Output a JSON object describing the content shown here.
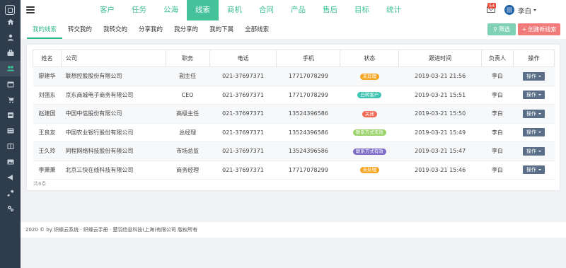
{
  "top_nav": {
    "items": [
      "客户",
      "任务",
      "公海",
      "线索",
      "商机",
      "合同",
      "产品",
      "售后",
      "目标",
      "统计"
    ],
    "active": "线索"
  },
  "user": {
    "name": "李白",
    "mail_badge": "54"
  },
  "sub_tabs": {
    "items": [
      "我的线索",
      "转交我的",
      "我转交的",
      "分享我的",
      "我分享的",
      "我的下属",
      "全部线索"
    ],
    "active": "我的线索"
  },
  "actions": {
    "filter_label": "筛选",
    "create_label": "创建新线索"
  },
  "table": {
    "headers": [
      "姓名",
      "公司",
      "职务",
      "电话",
      "手机",
      "状态",
      "跟进时间",
      "负责人",
      "操作"
    ],
    "rows": [
      {
        "name": "廖建华",
        "company": "联想控股股份有限公司",
        "title": "副主任",
        "phone": "021-37697371",
        "mobile": "17717078299",
        "status": "未处理",
        "status_color": "#f5a623",
        "time": "2019-03-21 21:56",
        "owner": "李白",
        "op": "操作"
      },
      {
        "name": "刘强东",
        "company": "京东商城电子商务有限公司",
        "title": "CEO",
        "phone": "021-37697371",
        "mobile": "17717078299",
        "status": "已转客户",
        "status_color": "#3ec4b0",
        "time": "2019-03-21 15:51",
        "owner": "李白",
        "op": "操作"
      },
      {
        "name": "赵建国",
        "company": "中国中信股份有限公司",
        "title": "高级主任",
        "phone": "021-37697371",
        "mobile": "13524396586",
        "status": "关闭",
        "status_color": "#ef6a57",
        "time": "2019-03-21 15:50",
        "owner": "李白",
        "op": "操作"
      },
      {
        "name": "王良友",
        "company": "中国农业银行股份有限公司",
        "title": "总经理",
        "phone": "021-37697371",
        "mobile": "13524396586",
        "status": "联系方式无效",
        "status_color": "#9bd36a",
        "time": "2019-03-21 15:49",
        "owner": "李白",
        "op": "操作"
      },
      {
        "name": "王久玲",
        "company": "同程网络科技股份有限公司",
        "title": "市场总监",
        "phone": "021-37697371",
        "mobile": "13524396586",
        "status": "联系方式有效",
        "status_color": "#7d6bc6",
        "time": "2019-03-21 15:47",
        "owner": "李白",
        "op": "操作"
      },
      {
        "name": "李萧萧",
        "company": "北京三快在线科技有限公司",
        "title": "商务经理",
        "phone": "021-37697371",
        "mobile": "17717078299",
        "status": "未处理",
        "status_color": "#f5a623",
        "time": "2019-03-21 15:46",
        "owner": "李白",
        "op": "操作"
      }
    ],
    "total_text": "共6条"
  },
  "footer": {
    "text": "2020 © by 织蝶云系统 · 织蝶云手册 · 楚羽信息科技(上海)有限公司 版权所有"
  },
  "colors": {
    "accent": "#46c29b",
    "rail_bg": "#2f3c4c",
    "create_btn": "#f07b7b",
    "filter_btn": "#7fd1b6",
    "op_btn": "#5a6f87"
  },
  "rail_icons": [
    "home-icon",
    "user-icon",
    "briefcase-icon",
    "users-icon",
    "calendar-icon",
    "cart-icon",
    "book-icon",
    "list-icon",
    "columns-icon",
    "image-icon",
    "megaphone-icon",
    "tools-icon",
    "settings-icon"
  ]
}
